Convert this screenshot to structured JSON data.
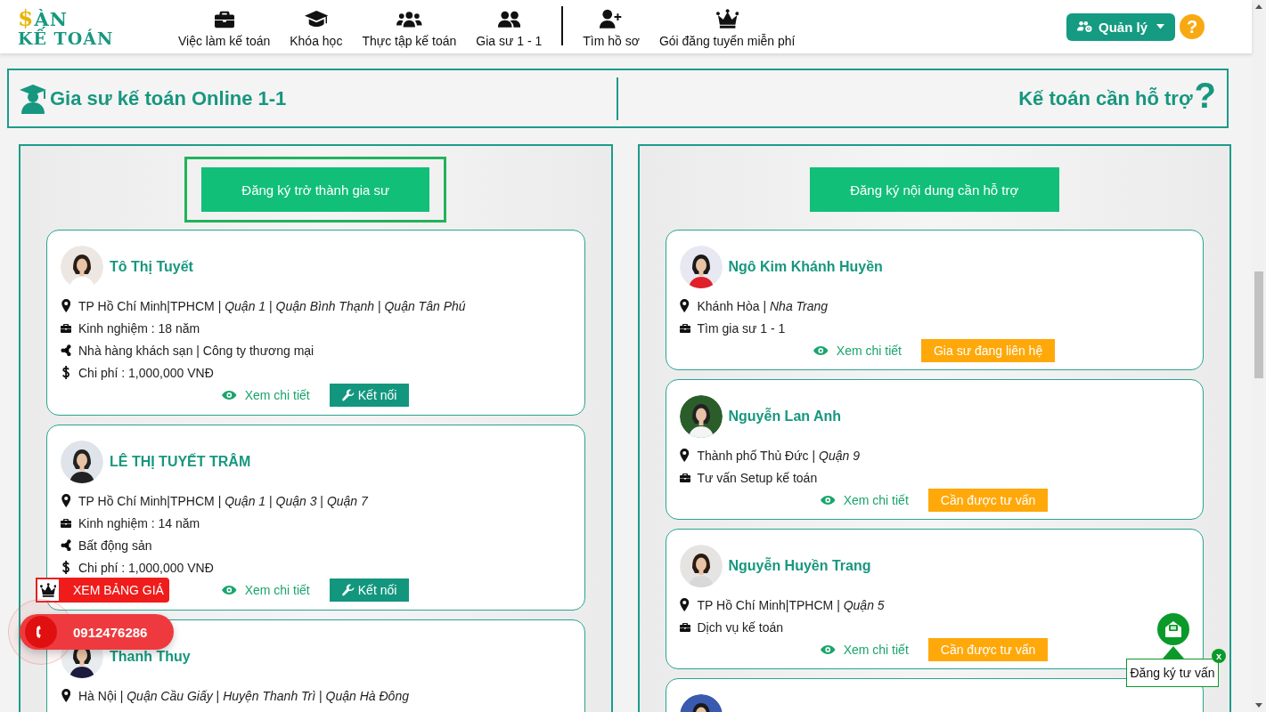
{
  "header": {
    "logo": {
      "symbol": "$",
      "top": "ÀN",
      "bottom": "KẾ TOÁN"
    },
    "nav": [
      {
        "label": "Việc làm kế toán"
      },
      {
        "label": "Khóa học"
      },
      {
        "label": "Thực tập kế toán"
      },
      {
        "label": "Gia sư 1 - 1"
      }
    ],
    "nav_secondary": [
      {
        "label": "Tìm hồ sơ"
      },
      {
        "label": "Gói đăng tuyển miễn phí"
      }
    ],
    "manage_button": "Quản lý",
    "help_button": "?"
  },
  "banner": {
    "left_title": "Gia sư kế toán Online 1-1",
    "right_title": "Kế toán cần hỗ trợ",
    "right_mark": "?"
  },
  "panels": [
    {
      "register_button": {
        "label": "Đăng ký trở thành gia sư",
        "highlighted": true
      },
      "cards": [
        {
          "name": "Tô Thị Tuyết",
          "lines": [
            {
              "kind": "location",
              "text": "TP Hồ Chí Minh|TPHCM | *Quận 1*  | *Quận Bình Thạnh*  | *Quận Tân Phú*"
            },
            {
              "kind": "experience",
              "text": "Kinh nghiệm : 18 năm"
            },
            {
              "kind": "field",
              "text": "Nhà hàng khách sạn | Công ty thương mại"
            },
            {
              "kind": "fee",
              "text": "Chi phí : 1,000,000 VNĐ"
            }
          ],
          "actions": {
            "link": "Xem chi tiết",
            "button": {
              "kind": "connect",
              "label": "Kết nối"
            }
          }
        },
        {
          "name": "LÊ THỊ TUYẾT TRÂM",
          "lines": [
            {
              "kind": "location",
              "text": "TP Hồ Chí Minh|TPHCM | *Quận 1*  | *Quận 3*  | *Quận 7*"
            },
            {
              "kind": "experience",
              "text": "Kinh nghiệm : 14 năm"
            },
            {
              "kind": "field",
              "text": "Bất động sản"
            },
            {
              "kind": "fee",
              "text": "Chi phí : 1,000,000 VNĐ"
            }
          ],
          "actions": {
            "link": "Xem chi tiết",
            "button": {
              "kind": "connect",
              "label": "Kết nối"
            }
          }
        },
        {
          "name": "Thanh Thuy",
          "lines": [
            {
              "kind": "location",
              "text": "Hà Nội | *Quận Cầu Giấy*  | *Huyện Thanh Trì*  | *Quận Hà Đông*"
            }
          ]
        }
      ]
    },
    {
      "register_button": {
        "label": "Đăng ký nội dung cần hỗ trợ",
        "highlighted": false
      },
      "cards": [
        {
          "name": "Ngô Kim Khánh Huyền",
          "lines": [
            {
              "kind": "location",
              "text": "Khánh Hòa | *Nha Trang*"
            },
            {
              "kind": "need",
              "text": "Tìm gia sư 1 - 1"
            }
          ],
          "actions": {
            "link": "Xem chi tiết",
            "button": {
              "kind": "status",
              "label": "Gia sư đang liên hệ"
            }
          }
        },
        {
          "name": "Nguyễn Lan Anh",
          "lines": [
            {
              "kind": "location",
              "text": "Thành phố Thủ Đức | *Quận 9*"
            },
            {
              "kind": "need",
              "text": "Tư vấn Setup kế toán"
            }
          ],
          "actions": {
            "link": "Xem chi tiết",
            "button": {
              "kind": "status",
              "label": "Cần được tư vấn"
            }
          }
        },
        {
          "name": "Nguyễn Huyền Trang",
          "lines": [
            {
              "kind": "location",
              "text": "TP Hồ Chí Minh|TPHCM | *Quận 5*"
            },
            {
              "kind": "need",
              "text": "Dịch vụ kế toán"
            }
          ],
          "actions": {
            "link": "Xem chi tiết",
            "button": {
              "kind": "status",
              "label": "Cần được tư vấn"
            }
          }
        },
        {
          "kind": "partial"
        }
      ]
    }
  ],
  "floating": {
    "price_button": "XEM BẢNG GIÁ",
    "phone": "0912476286",
    "consult": {
      "label": "Đăng ký tư vấn",
      "close": "x"
    }
  }
}
